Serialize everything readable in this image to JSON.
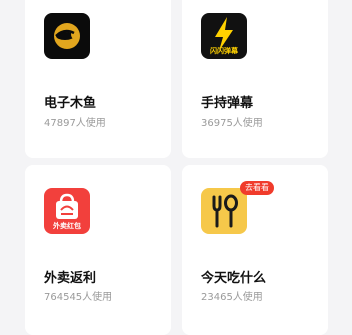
{
  "apps": [
    {
      "name": "电子木鱼",
      "usage": "47897人使用",
      "icon": "golden-fish-icon"
    },
    {
      "name": "手持弹幕",
      "usage": "36975人使用",
      "icon": "lightning-icon",
      "icon_label": "闪闪弹幕"
    },
    {
      "name": "外卖返利",
      "usage": "764545人使用",
      "icon": "shopping-bag-icon",
      "icon_label": "外卖红包"
    },
    {
      "name": "今天吃什么",
      "usage": "23465人使用",
      "icon": "fork-spoon-icon",
      "badge": "去看看"
    }
  ]
}
